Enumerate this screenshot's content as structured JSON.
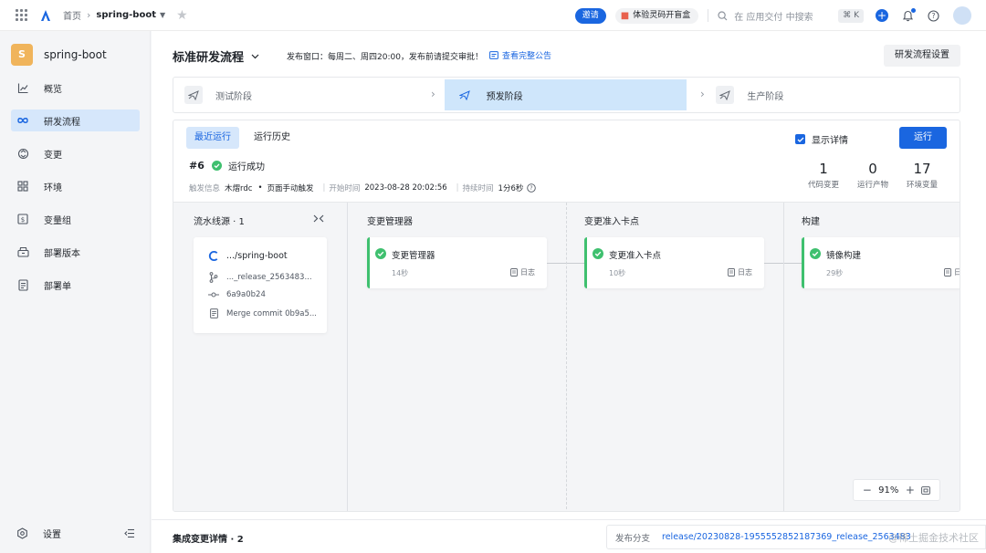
{
  "topbar": {
    "breadcrumb_home": "首页",
    "project": "spring-boot",
    "invite_label": "邀请",
    "promo_label": "体验灵码开盲盒",
    "search_placeholder": "在 应用交付 中搜索",
    "shortcut": "⌘ K"
  },
  "sidebar": {
    "project_initial": "S",
    "project_name": "spring-boot",
    "items": [
      {
        "label": "概览",
        "icon": "chart-line-icon",
        "active": false
      },
      {
        "label": "研发流程",
        "icon": "infinity-icon",
        "active": true
      },
      {
        "label": "变更",
        "icon": "change-icon",
        "active": false
      },
      {
        "label": "环境",
        "icon": "grid-icon",
        "active": false
      },
      {
        "label": "变量组",
        "icon": "variable-icon",
        "active": false
      },
      {
        "label": "部署版本",
        "icon": "package-icon",
        "active": false
      },
      {
        "label": "部署单",
        "icon": "document-icon",
        "active": false
      }
    ],
    "settings_label": "设置"
  },
  "header": {
    "title": "标准研发流程",
    "notice": "发布窗口：每周二、周四20:00，发布前请提交审批！",
    "notice_link": "查看完整公告",
    "settings_button": "研发流程设置"
  },
  "stages": [
    {
      "label": "测试阶段",
      "active": false
    },
    {
      "label": "预发阶段",
      "active": true
    },
    {
      "label": "生产阶段",
      "active": false
    }
  ],
  "run": {
    "tabs": [
      {
        "label": "最近运行",
        "active": true
      },
      {
        "label": "运行历史",
        "active": false
      }
    ],
    "show_detail_label": "显示详情",
    "run_button": "运行",
    "number": "#6",
    "status": "运行成功",
    "trigger_label": "触发信息",
    "trigger_user": "木熠rdc",
    "trigger_method": "页面手动触发",
    "start_label": "开始时间",
    "start_time": "2023-08-28 20:02:56",
    "duration_label": "持续时间",
    "duration": "1分6秒",
    "stats": [
      {
        "value": "1",
        "label": "代码变更"
      },
      {
        "value": "0",
        "label": "运行产物"
      },
      {
        "value": "17",
        "label": "环境变量"
      }
    ]
  },
  "pipeline": {
    "source_title": "流水线源 · 1",
    "source": {
      "repo": ".../spring-boot",
      "branch": "..._release_2563483...",
      "commit": "6a9a0b24",
      "message": "Merge commit 0b9a5..."
    },
    "columns": [
      {
        "title": "变更管理器",
        "job": "变更管理器",
        "duration": "14秒",
        "log": "日志"
      },
      {
        "title": "变更准入卡点",
        "job": "变更准入卡点",
        "duration": "10秒",
        "log": "日志"
      },
      {
        "title": "构建",
        "job": "镜像构建",
        "duration": "29秒",
        "log": "日志"
      }
    ],
    "zoom": "91%"
  },
  "bottom": {
    "title": "集成变更详情 · 2",
    "branch_label": "发布分支",
    "branch_value": "release/20230828-1955552852187369_release_2563483",
    "watermark": "@稀土掘金技术社区"
  },
  "colors": {
    "accent": "#1a66e0",
    "success": "#3fc06f",
    "active_bg": "#d6e7fb",
    "project_avatar": "#f0b45b"
  }
}
